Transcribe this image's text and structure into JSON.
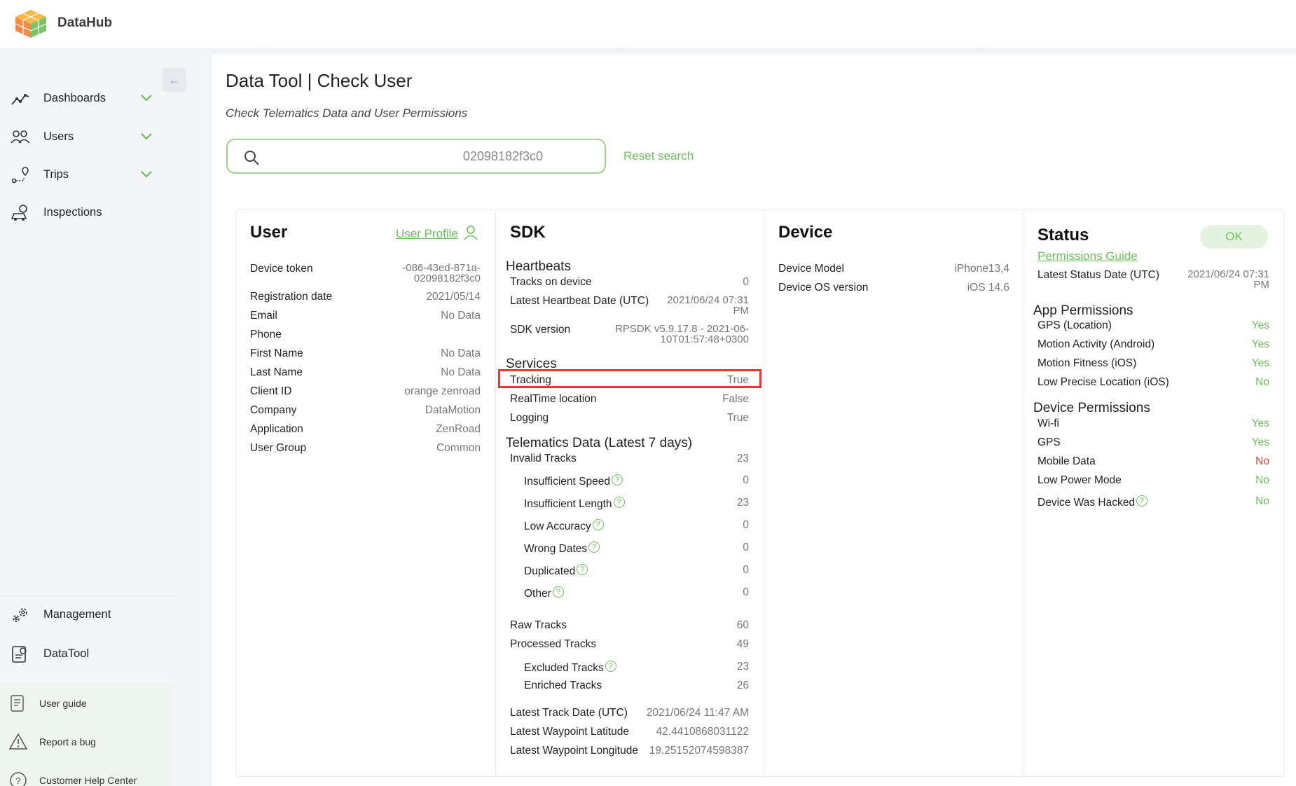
{
  "brand": "DataHub",
  "sidebar": {
    "collapse_icon": "arrow-left",
    "items": [
      {
        "label": "Dashboards",
        "icon": "line-chart-icon",
        "chevron": true
      },
      {
        "label": "Users",
        "icon": "users-icon",
        "chevron": true
      },
      {
        "label": "Trips",
        "icon": "route-pin-icon",
        "chevron": true
      },
      {
        "label": "Inspections",
        "icon": "car-inspection-icon",
        "chevron": false
      }
    ],
    "bottom_items": [
      {
        "label": "Management",
        "icon": "gears-icon"
      },
      {
        "label": "DataTool",
        "icon": "data-tool-icon"
      }
    ],
    "help_items": [
      {
        "label": "User guide",
        "icon": "guide-icon"
      },
      {
        "label": "Report a bug",
        "icon": "warning-icon"
      },
      {
        "label": "Customer Help Center",
        "icon": "help-circle-icon"
      }
    ]
  },
  "page": {
    "title": "Data Tool | Check User",
    "subtitle": "Check Telematics Data and User Permissions"
  },
  "search": {
    "value": "02098182f3c0",
    "reset_label": "Reset search"
  },
  "user": {
    "title": "User",
    "profile_link": "User Profile",
    "rows": [
      {
        "k": "Device token",
        "v": "-086-43ed-871a-\n02098182f3c0"
      },
      {
        "k": "Registration date",
        "v": "2021/05/14"
      },
      {
        "k": "Email",
        "v": "No Data"
      },
      {
        "k": "Phone",
        "v": ""
      },
      {
        "k": "First Name",
        "v": "No Data"
      },
      {
        "k": "Last Name",
        "v": "No Data"
      },
      {
        "k": "Client ID",
        "v": "orange zenroad"
      },
      {
        "k": "Company",
        "v": "DataMotion"
      },
      {
        "k": "Application",
        "v": "ZenRoad"
      },
      {
        "k": "User Group",
        "v": "Common"
      }
    ]
  },
  "sdk": {
    "title": "SDK",
    "heartbeats_title": "Heartbeats",
    "heartbeats": [
      {
        "k": "Tracks on device",
        "v": "0"
      },
      {
        "k": "Latest Heartbeat Date (UTC)",
        "v": "2021/06/24 07:31\nPM"
      },
      {
        "k": "SDK version",
        "v": "RPSDK v5.9.17.8 - 2021-06-\n10T01:57:48+0300"
      }
    ],
    "services_title": "Services",
    "services": [
      {
        "k": "Tracking",
        "v": "True"
      },
      {
        "k": "RealTime location",
        "v": "False"
      },
      {
        "k": "Logging",
        "v": "True"
      }
    ],
    "telematics_title": "Telematics Data (Latest 7 days)",
    "invalid": {
      "k": "Invalid Tracks",
      "v": "23"
    },
    "invalid_sub": [
      {
        "k": "Insufficient Speed",
        "v": "0"
      },
      {
        "k": "Insufficient Length",
        "v": "23"
      },
      {
        "k": "Low Accuracy",
        "v": "0"
      },
      {
        "k": "Wrong Dates",
        "v": "0"
      },
      {
        "k": "Duplicated",
        "v": "0"
      },
      {
        "k": "Other",
        "v": "0"
      }
    ],
    "raw": {
      "k": "Raw Tracks",
      "v": "60"
    },
    "processed": {
      "k": "Processed Tracks",
      "v": "49"
    },
    "processed_sub": [
      {
        "k": "Excluded Tracks",
        "v": "23",
        "help": true
      },
      {
        "k": "Enriched Tracks",
        "v": "26",
        "help": false
      }
    ],
    "latest": [
      {
        "k": "Latest Track Date (UTC)",
        "v": "2021/06/24 11:47 AM"
      },
      {
        "k": "Latest Waypoint Latitude",
        "v": "42.4410868031122"
      },
      {
        "k": "Latest Waypoint Longitude",
        "v": "19.25152074598387"
      }
    ]
  },
  "device": {
    "title": "Device",
    "rows": [
      {
        "k": "Device Model",
        "v": "iPhone13,4"
      },
      {
        "k": "Device OS version",
        "v": "iOS 14.6"
      }
    ]
  },
  "status": {
    "title": "Status",
    "badge": "OK",
    "guide_link": "Permissions Guide",
    "latest": {
      "k": "Latest Status Date (UTC)",
      "v": "2021/06/24 07:31\nPM"
    },
    "app_title": "App Permissions",
    "app": [
      {
        "k": "GPS (Location)",
        "v": "Yes",
        "ok": true
      },
      {
        "k": "Motion Activity (Android)",
        "v": "Yes",
        "ok": true
      },
      {
        "k": "Motion Fitness (iOS)",
        "v": "Yes",
        "ok": true
      },
      {
        "k": "Low Precise Location (iOS)",
        "v": "No",
        "ok": true
      }
    ],
    "device_title": "Device Permissions",
    "device": [
      {
        "k": "Wi-fi",
        "v": "Yes",
        "ok": true
      },
      {
        "k": "GPS",
        "v": "Yes",
        "ok": true
      },
      {
        "k": "Mobile Data",
        "v": "No",
        "ok": false
      },
      {
        "k": "Low Power Mode",
        "v": "No",
        "ok": true
      },
      {
        "k": "Device Was Hacked",
        "v": "No",
        "ok": true
      }
    ]
  },
  "colors": {
    "accent": "#6abf5a",
    "danger": "#e0453a",
    "highlight": "#e23a2f"
  }
}
